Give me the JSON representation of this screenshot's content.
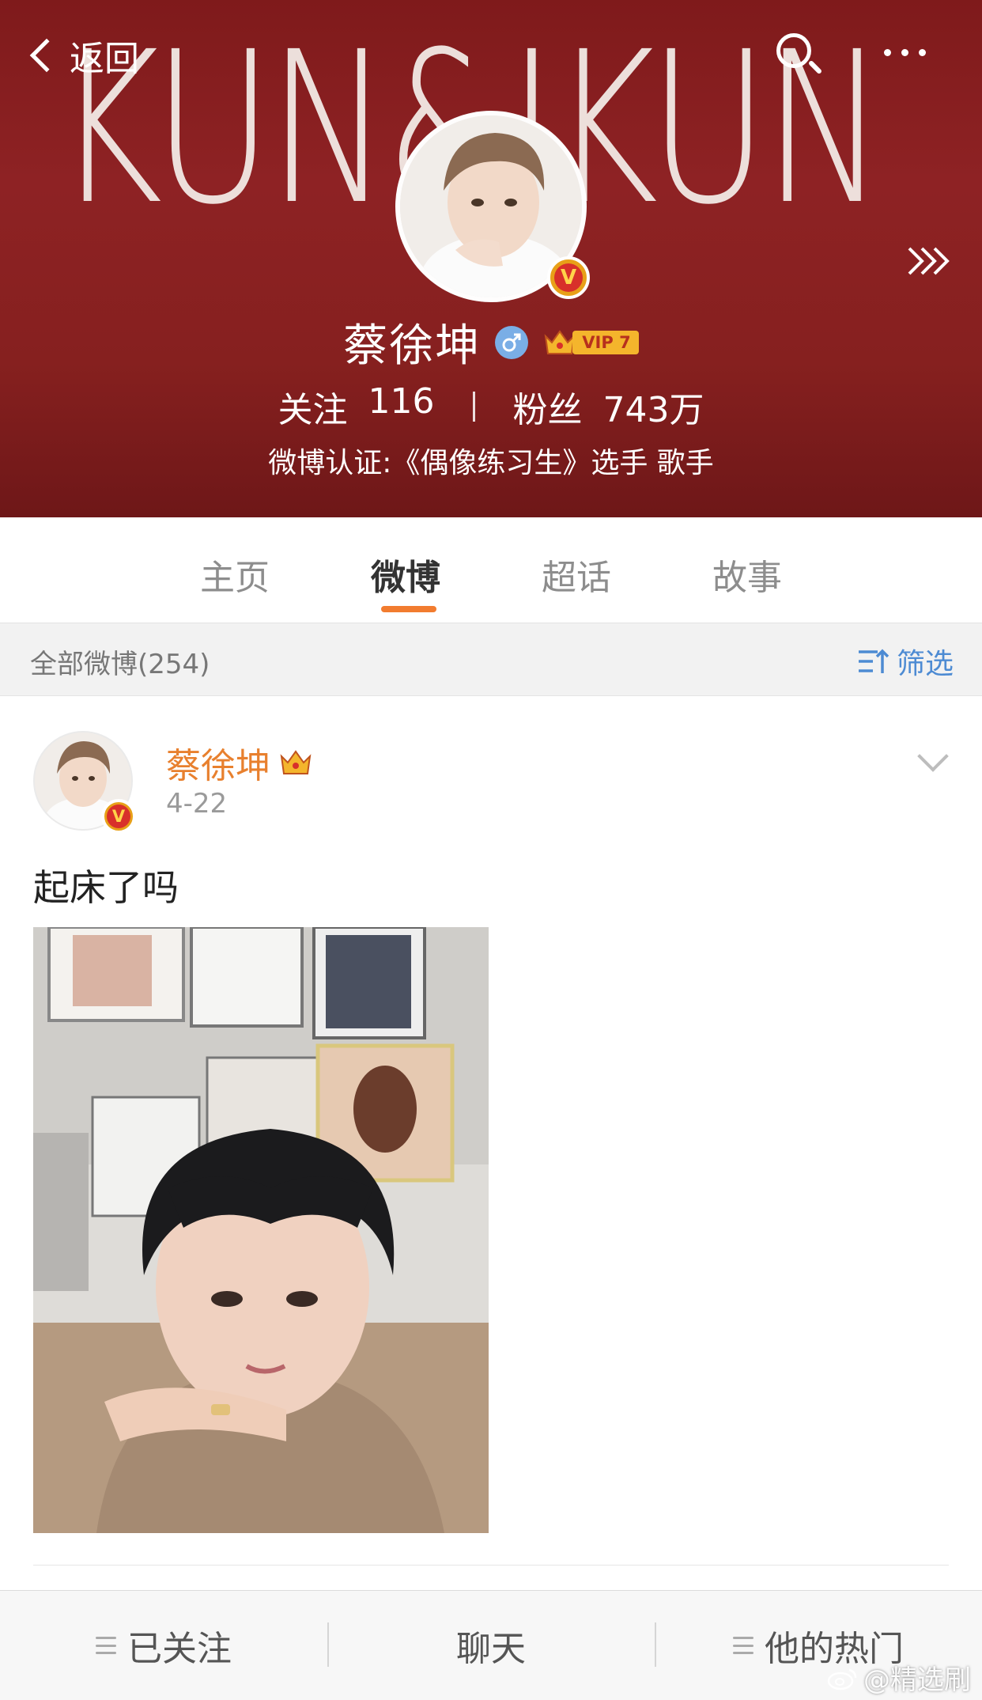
{
  "header": {
    "banner_text": "KUN&IKUN",
    "back_label": "返回",
    "profile_name": "蔡徐坤",
    "vip_label": "VIP 7",
    "verify_badge": "V",
    "following_label": "关注",
    "following_count": "116",
    "fans_label": "粉丝",
    "fans_count": "743万",
    "verification": "微博认证:《偶像练习生》选手 歌手",
    "colors": {
      "banner": "#86201f",
      "accent": "#f27c2f"
    }
  },
  "tabs": [
    {
      "label": "主页",
      "active": false
    },
    {
      "label": "微博",
      "active": true
    },
    {
      "label": "超话",
      "active": false
    },
    {
      "label": "故事",
      "active": false
    }
  ],
  "filter": {
    "count_label": "全部微博(254)",
    "button_label": "筛选"
  },
  "post": {
    "author": "蔡徐坤",
    "date": "4-22",
    "text": "起床了吗",
    "verify_badge": "V"
  },
  "bottom_bar": {
    "followed_label": "已关注",
    "chat_label": "聊天",
    "hot_label": "他的热门"
  },
  "watermark": "@精选刷",
  "icons": [
    "back-chevron-icon",
    "search-icon",
    "more-icon",
    "forward-arrows-icon",
    "male-icon",
    "crown-icon",
    "filter-icon",
    "chevron-down-icon",
    "menu-lines-icon",
    "weibo-logo-icon"
  ]
}
